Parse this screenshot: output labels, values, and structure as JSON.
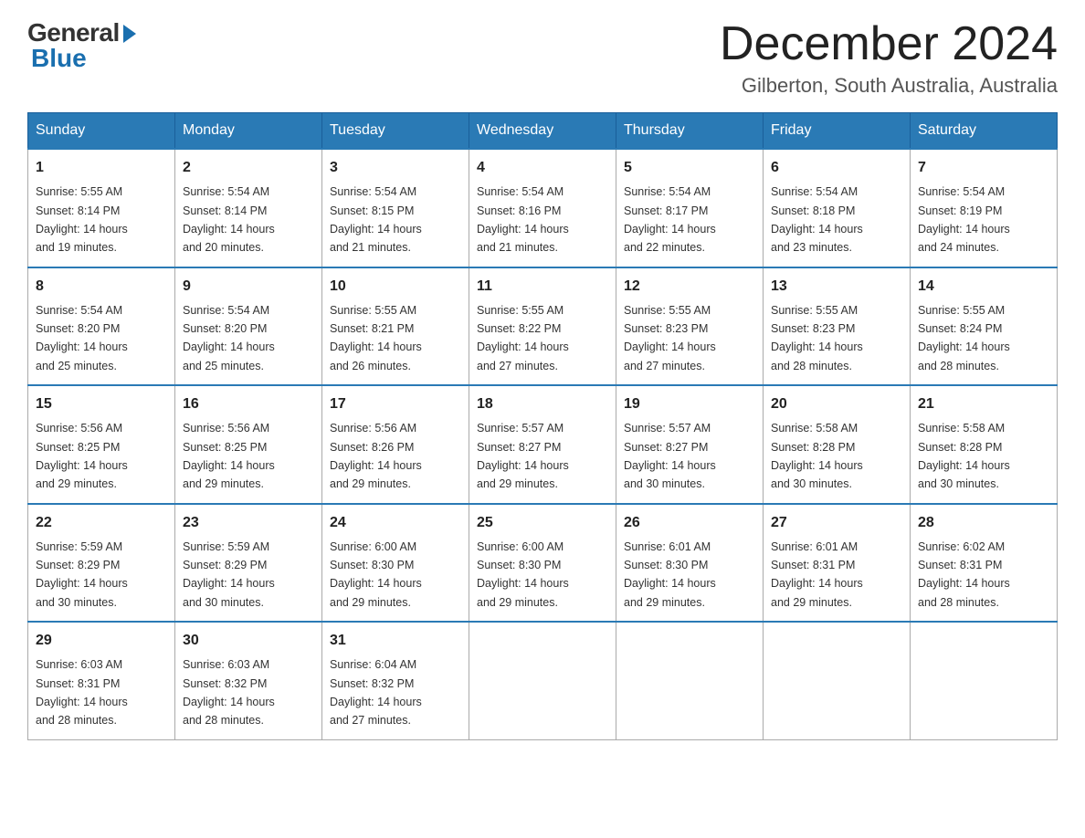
{
  "header": {
    "logo_general": "General",
    "logo_blue": "Blue",
    "month_title": "December 2024",
    "location": "Gilberton, South Australia, Australia"
  },
  "days_of_week": [
    "Sunday",
    "Monday",
    "Tuesday",
    "Wednesday",
    "Thursday",
    "Friday",
    "Saturday"
  ],
  "weeks": [
    [
      {
        "day": "1",
        "sunrise": "5:55 AM",
        "sunset": "8:14 PM",
        "daylight": "14 hours and 19 minutes."
      },
      {
        "day": "2",
        "sunrise": "5:54 AM",
        "sunset": "8:14 PM",
        "daylight": "14 hours and 20 minutes."
      },
      {
        "day": "3",
        "sunrise": "5:54 AM",
        "sunset": "8:15 PM",
        "daylight": "14 hours and 21 minutes."
      },
      {
        "day": "4",
        "sunrise": "5:54 AM",
        "sunset": "8:16 PM",
        "daylight": "14 hours and 21 minutes."
      },
      {
        "day": "5",
        "sunrise": "5:54 AM",
        "sunset": "8:17 PM",
        "daylight": "14 hours and 22 minutes."
      },
      {
        "day": "6",
        "sunrise": "5:54 AM",
        "sunset": "8:18 PM",
        "daylight": "14 hours and 23 minutes."
      },
      {
        "day": "7",
        "sunrise": "5:54 AM",
        "sunset": "8:19 PM",
        "daylight": "14 hours and 24 minutes."
      }
    ],
    [
      {
        "day": "8",
        "sunrise": "5:54 AM",
        "sunset": "8:20 PM",
        "daylight": "14 hours and 25 minutes."
      },
      {
        "day": "9",
        "sunrise": "5:54 AM",
        "sunset": "8:20 PM",
        "daylight": "14 hours and 25 minutes."
      },
      {
        "day": "10",
        "sunrise": "5:55 AM",
        "sunset": "8:21 PM",
        "daylight": "14 hours and 26 minutes."
      },
      {
        "day": "11",
        "sunrise": "5:55 AM",
        "sunset": "8:22 PM",
        "daylight": "14 hours and 27 minutes."
      },
      {
        "day": "12",
        "sunrise": "5:55 AM",
        "sunset": "8:23 PM",
        "daylight": "14 hours and 27 minutes."
      },
      {
        "day": "13",
        "sunrise": "5:55 AM",
        "sunset": "8:23 PM",
        "daylight": "14 hours and 28 minutes."
      },
      {
        "day": "14",
        "sunrise": "5:55 AM",
        "sunset": "8:24 PM",
        "daylight": "14 hours and 28 minutes."
      }
    ],
    [
      {
        "day": "15",
        "sunrise": "5:56 AM",
        "sunset": "8:25 PM",
        "daylight": "14 hours and 29 minutes."
      },
      {
        "day": "16",
        "sunrise": "5:56 AM",
        "sunset": "8:25 PM",
        "daylight": "14 hours and 29 minutes."
      },
      {
        "day": "17",
        "sunrise": "5:56 AM",
        "sunset": "8:26 PM",
        "daylight": "14 hours and 29 minutes."
      },
      {
        "day": "18",
        "sunrise": "5:57 AM",
        "sunset": "8:27 PM",
        "daylight": "14 hours and 29 minutes."
      },
      {
        "day": "19",
        "sunrise": "5:57 AM",
        "sunset": "8:27 PM",
        "daylight": "14 hours and 30 minutes."
      },
      {
        "day": "20",
        "sunrise": "5:58 AM",
        "sunset": "8:28 PM",
        "daylight": "14 hours and 30 minutes."
      },
      {
        "day": "21",
        "sunrise": "5:58 AM",
        "sunset": "8:28 PM",
        "daylight": "14 hours and 30 minutes."
      }
    ],
    [
      {
        "day": "22",
        "sunrise": "5:59 AM",
        "sunset": "8:29 PM",
        "daylight": "14 hours and 30 minutes."
      },
      {
        "day": "23",
        "sunrise": "5:59 AM",
        "sunset": "8:29 PM",
        "daylight": "14 hours and 30 minutes."
      },
      {
        "day": "24",
        "sunrise": "6:00 AM",
        "sunset": "8:30 PM",
        "daylight": "14 hours and 29 minutes."
      },
      {
        "day": "25",
        "sunrise": "6:00 AM",
        "sunset": "8:30 PM",
        "daylight": "14 hours and 29 minutes."
      },
      {
        "day": "26",
        "sunrise": "6:01 AM",
        "sunset": "8:30 PM",
        "daylight": "14 hours and 29 minutes."
      },
      {
        "day": "27",
        "sunrise": "6:01 AM",
        "sunset": "8:31 PM",
        "daylight": "14 hours and 29 minutes."
      },
      {
        "day": "28",
        "sunrise": "6:02 AM",
        "sunset": "8:31 PM",
        "daylight": "14 hours and 28 minutes."
      }
    ],
    [
      {
        "day": "29",
        "sunrise": "6:03 AM",
        "sunset": "8:31 PM",
        "daylight": "14 hours and 28 minutes."
      },
      {
        "day": "30",
        "sunrise": "6:03 AM",
        "sunset": "8:32 PM",
        "daylight": "14 hours and 28 minutes."
      },
      {
        "day": "31",
        "sunrise": "6:04 AM",
        "sunset": "8:32 PM",
        "daylight": "14 hours and 27 minutes."
      },
      null,
      null,
      null,
      null
    ]
  ],
  "labels": {
    "sunrise": "Sunrise:",
    "sunset": "Sunset:",
    "daylight": "Daylight:"
  }
}
